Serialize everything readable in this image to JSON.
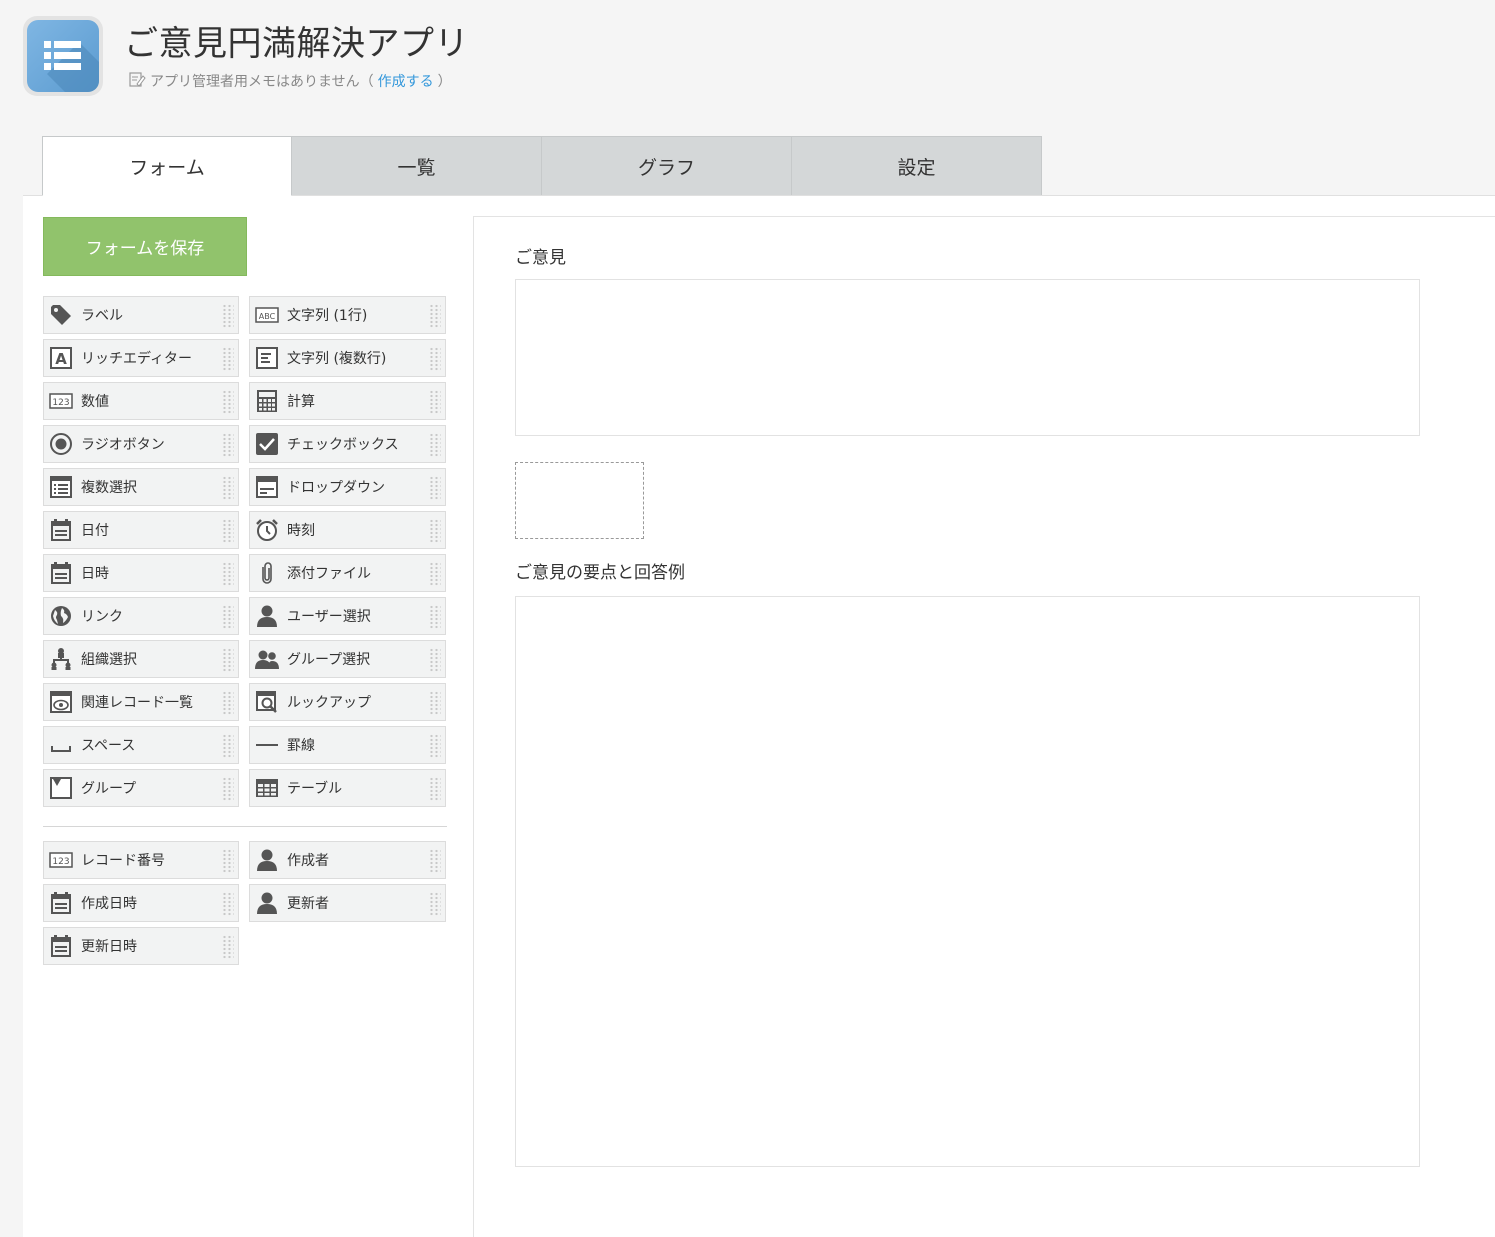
{
  "header": {
    "app_title": "ご意見円満解決アプリ",
    "memo_text": "アプリ管理者用メモはありません（",
    "memo_link": "作成する",
    "memo_close": "）"
  },
  "tabs": [
    {
      "label": "フォーム",
      "active": true
    },
    {
      "label": "一覧"
    },
    {
      "label": "グラフ"
    },
    {
      "label": "設定"
    }
  ],
  "save_button": "フォームを保存",
  "palette": {
    "fields": [
      {
        "label": "ラベル",
        "icon": "tag-icon"
      },
      {
        "label": "文字列 (1行)",
        "icon": "abc-icon"
      },
      {
        "label": "リッチエディター",
        "icon": "rich-editor-icon"
      },
      {
        "label": "文字列 (複数行)",
        "icon": "multiline-text-icon"
      },
      {
        "label": "数値",
        "icon": "number-icon"
      },
      {
        "label": "計算",
        "icon": "calculator-icon"
      },
      {
        "label": "ラジオボタン",
        "icon": "radio-icon"
      },
      {
        "label": "チェックボックス",
        "icon": "checkbox-icon"
      },
      {
        "label": "複数選択",
        "icon": "multi-select-icon"
      },
      {
        "label": "ドロップダウン",
        "icon": "dropdown-icon"
      },
      {
        "label": "日付",
        "icon": "calendar-icon"
      },
      {
        "label": "時刻",
        "icon": "clock-icon"
      },
      {
        "label": "日時",
        "icon": "calendar-icon"
      },
      {
        "label": "添付ファイル",
        "icon": "paperclip-icon"
      },
      {
        "label": "リンク",
        "icon": "globe-icon"
      },
      {
        "label": "ユーザー選択",
        "icon": "user-icon"
      },
      {
        "label": "組織選択",
        "icon": "org-icon"
      },
      {
        "label": "グループ選択",
        "icon": "group-icon"
      },
      {
        "label": "関連レコード一覧",
        "icon": "related-records-icon"
      },
      {
        "label": "ルックアップ",
        "icon": "lookup-icon"
      },
      {
        "label": "スペース",
        "icon": "space-icon"
      },
      {
        "label": "罫線",
        "icon": "line-icon"
      },
      {
        "label": "グループ",
        "icon": "group-box-icon"
      },
      {
        "label": "テーブル",
        "icon": "table-icon"
      }
    ],
    "system_fields": [
      {
        "label": "レコード番号",
        "icon": "number-icon"
      },
      {
        "label": "作成者",
        "icon": "user-icon"
      },
      {
        "label": "作成日時",
        "icon": "calendar-icon"
      },
      {
        "label": "更新者",
        "icon": "user-icon"
      },
      {
        "label": "更新日時",
        "icon": "calendar-icon"
      }
    ]
  },
  "form": {
    "field1_label": "ご意見",
    "field2_label": "ご意見の要点と回答例"
  }
}
